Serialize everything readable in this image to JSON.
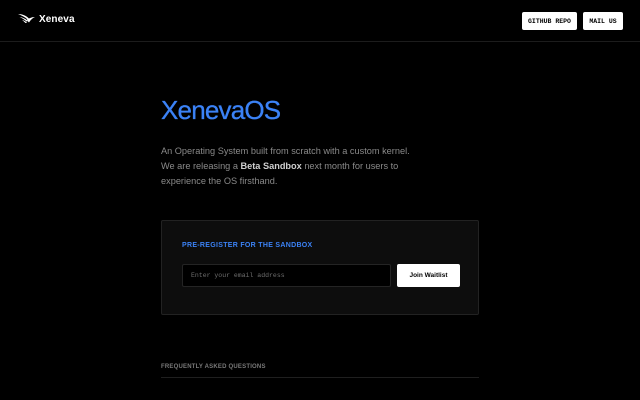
{
  "header": {
    "brand": "Xeneva",
    "logo_icon": "bird-wing-logo-icon",
    "github_label": "GITHUB REPO",
    "mail_label": "MAIL US"
  },
  "hero": {
    "title": "XenevaOS",
    "line1": "An Operating System built from scratch with a custom kernel.",
    "line2_prefix": "We are releasing a ",
    "line2_bold": "Beta Sandbox",
    "line2_suffix": " next month for users to",
    "line3": "experience the OS firsthand."
  },
  "register": {
    "heading": "PRE-REGISTER FOR THE SANDBOX",
    "email_placeholder": "Enter your email address",
    "email_value": "",
    "join_label": "Join Waitlist"
  },
  "faq": {
    "heading": "FREQUENTLY ASKED QUESTIONS"
  },
  "colors": {
    "background": "#000000",
    "accent": "#3b82f6",
    "button_bg": "#ffffff",
    "card_bg": "#0d0d0d"
  }
}
